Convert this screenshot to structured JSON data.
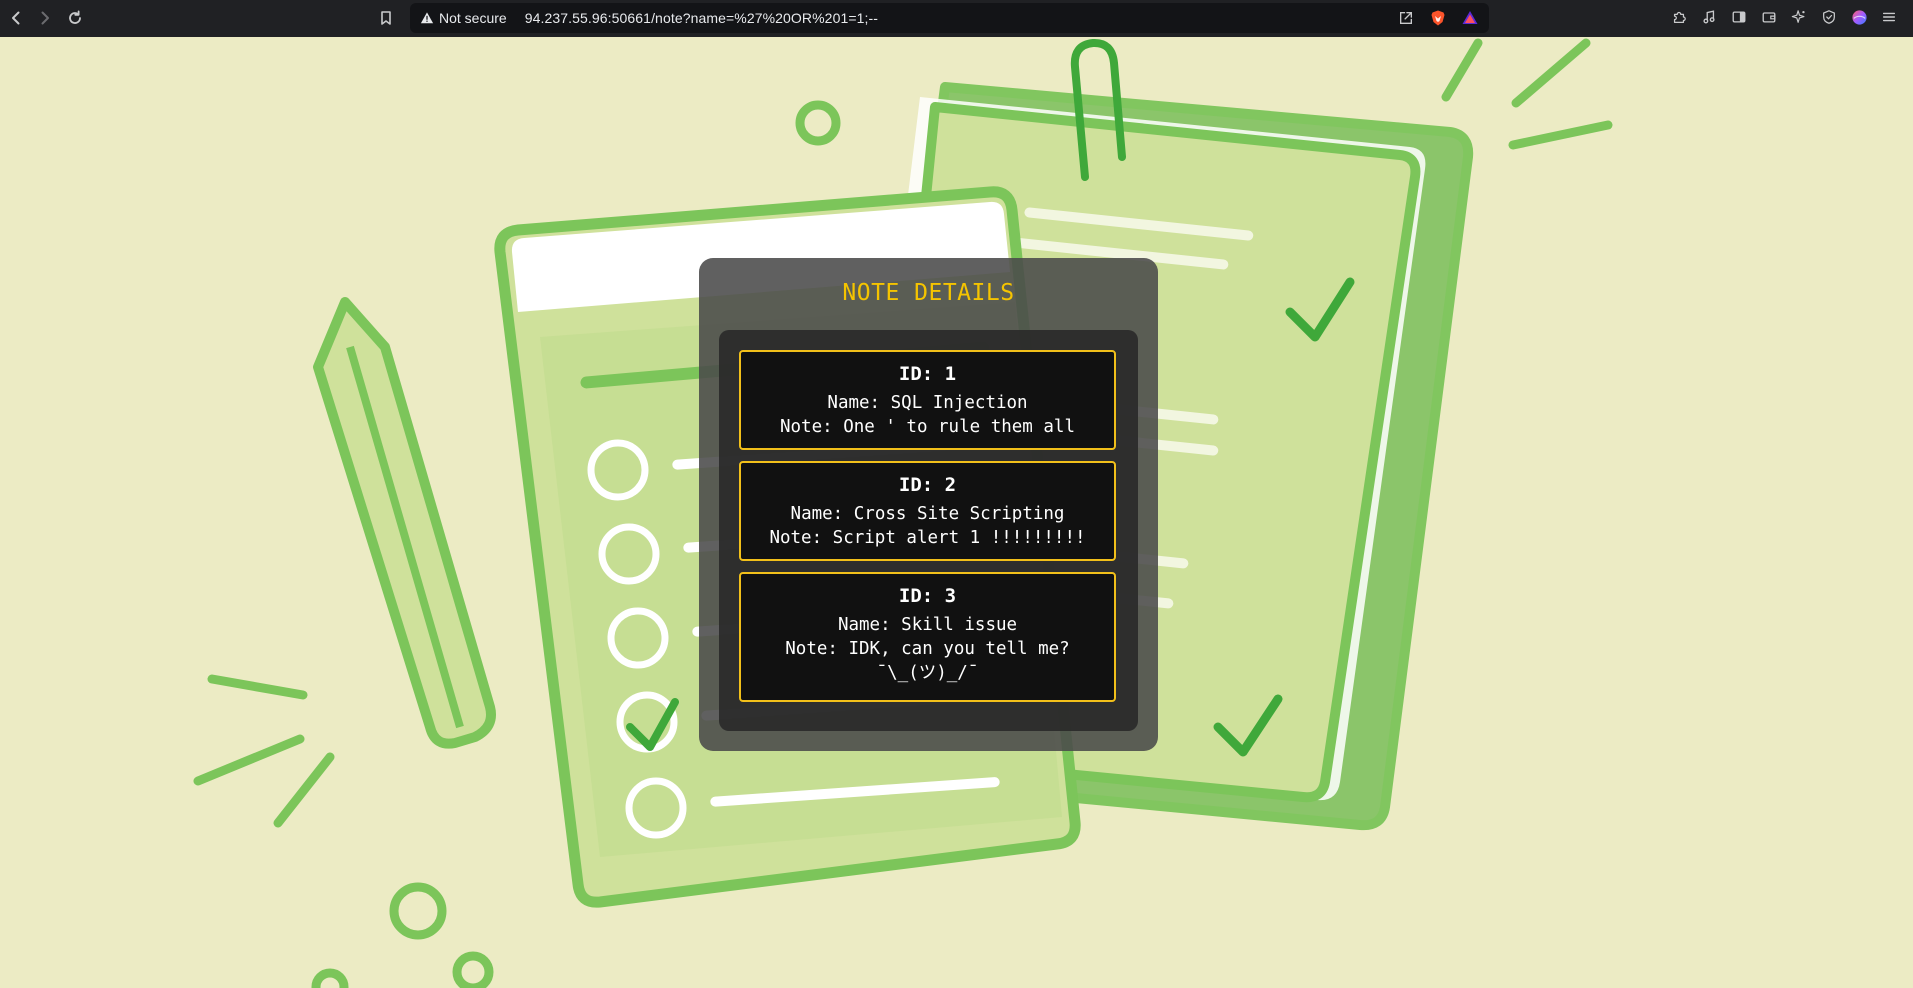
{
  "browser": {
    "security_status": "Not secure",
    "url": "94.237.55.96:50661/note?name=%27%20OR%201=1;--"
  },
  "page": {
    "title": "NOTE DETAILS",
    "notes": [
      {
        "id_label": "ID: 1",
        "name_label": "Name: SQL Injection",
        "note_label": "Note: One ' to rule them all",
        "extra": ""
      },
      {
        "id_label": "ID: 2",
        "name_label": "Name: Cross Site Scripting",
        "note_label": "Note: Script alert 1 !!!!!!!!!",
        "extra": ""
      },
      {
        "id_label": "ID: 3",
        "name_label": "Name: Skill issue",
        "note_label": "Note: IDK, can you tell me?",
        "extra": "¯\\_(ツ)_/¯"
      }
    ]
  },
  "colors": {
    "accent": "#f5c400",
    "card_border": "#f2c01a",
    "page_bg": "#ecebc4",
    "art_green": "#7cc55a"
  }
}
